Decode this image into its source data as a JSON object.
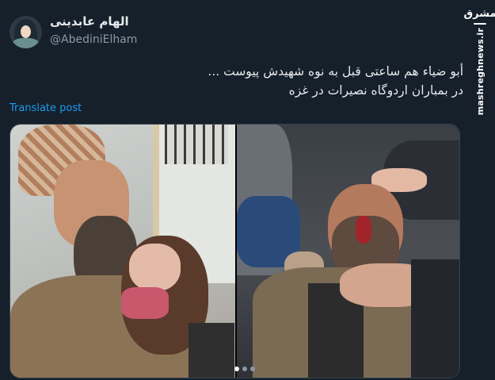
{
  "author": {
    "display_name": "الهام عابدینی",
    "handle": "@AbediniElham"
  },
  "tweet": {
    "line1": "أبو ضياء هم ساعتی قبل به نوه شهیدش پیوست ...",
    "line2": "در بمباران اردوگاه نصیرات در غزه",
    "translate_label": "Translate post"
  },
  "media": {
    "left_photo_label": "photo-left",
    "right_photo_label": "photo-right",
    "carousel_total": 3,
    "carousel_active": 0
  },
  "watermark": {
    "logo": "مشرق",
    "url": "mashreghnews.ir"
  },
  "colors": {
    "background": "#15202b",
    "link": "#1d9bf0",
    "secondary_text": "#8b98a5"
  }
}
